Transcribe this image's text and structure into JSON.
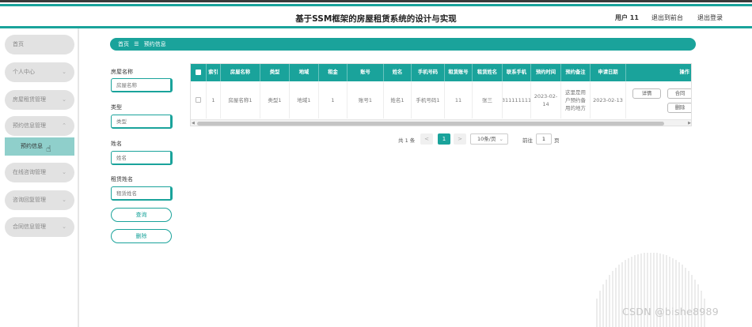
{
  "header": {
    "title": "基于SSM框架的房屋租赁系统的设计与实现",
    "user": "用户 11",
    "back_link": "退出到前台",
    "logout": "退出登录"
  },
  "sidebar": {
    "items": [
      {
        "label": "首页",
        "has_chevron": false
      },
      {
        "label": "个人中心",
        "has_chevron": true
      },
      {
        "label": "房屋租赁管理",
        "has_chevron": true
      },
      {
        "label": "预约信息管理",
        "has_chevron": true
      },
      {
        "label": "在线咨询管理",
        "has_chevron": true
      },
      {
        "label": "咨询回复管理",
        "has_chevron": true
      },
      {
        "label": "合同信息管理",
        "has_chevron": true
      }
    ],
    "sub_item": "预约信息"
  },
  "breadcrumb": {
    "home": "首页",
    "separator": "☰",
    "current": "预约信息"
  },
  "search": {
    "fields": [
      {
        "label": "房屋名称",
        "placeholder": "房屋名称"
      },
      {
        "label": "类型",
        "placeholder": "类型"
      },
      {
        "label": "姓名",
        "placeholder": "姓名"
      },
      {
        "label": "租赁姓名",
        "placeholder": "租赁姓名"
      }
    ],
    "query_button": "查询",
    "delete_button": "删除"
  },
  "table": {
    "columns": [
      "",
      "索引",
      "房屋名称",
      "类型",
      "地域",
      "租金",
      "账号",
      "姓名",
      "手机号码",
      "租赁账号",
      "租赁姓名",
      "联系手机",
      "预约时间",
      "预约备注",
      "申请日期",
      "操作"
    ],
    "rows": [
      {
        "cells": [
          "",
          "1",
          "房屋名称1",
          "类型1",
          "地域1",
          "1",
          "账号1",
          "姓名1",
          "手机号码1",
          "11",
          "张三",
          "13111111111",
          "2023-02-14",
          "这里是用户预约备用的地方",
          "2023-02-13"
        ],
        "actions": [
          "详情",
          "合同",
          "删除"
        ]
      }
    ]
  },
  "pagination": {
    "total": "共 1 条",
    "prev": "<",
    "current": "1",
    "next": ">",
    "page_size": "10条/页",
    "goto_label": "前往",
    "goto_value": "1",
    "page_suffix": "页"
  },
  "watermark": "CSDN @bishe8989",
  "colors": {
    "accent": "#1aa39b",
    "sidebar_item": "#e2e2e2",
    "sidebar_active": "#8fcfcb"
  }
}
